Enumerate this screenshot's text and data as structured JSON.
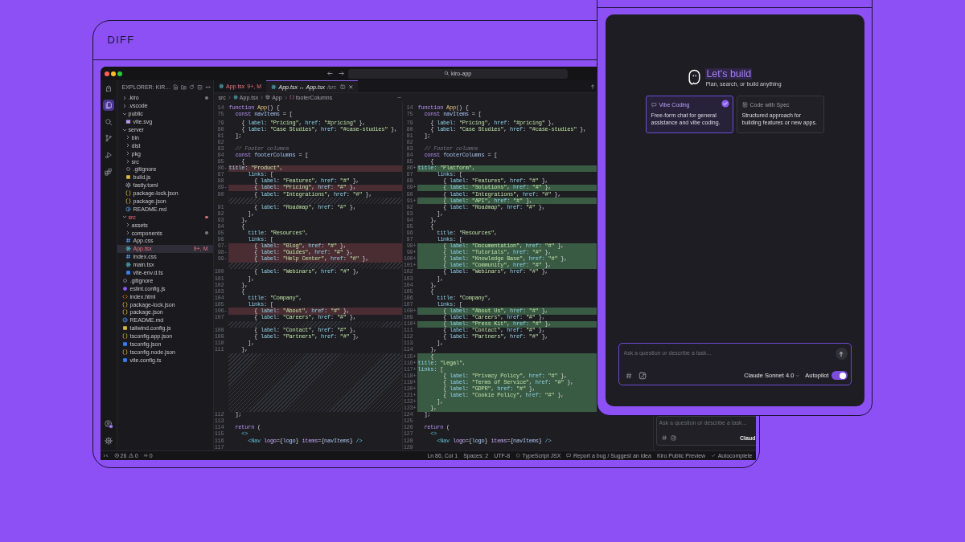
{
  "frame": {
    "label": "DIFF"
  },
  "title_bar": {
    "search": "kiro-app"
  },
  "activity_bar": {
    "top": [
      {
        "kind": "logo",
        "selected": false
      },
      {
        "kind": "explorer",
        "selected": true
      },
      {
        "kind": "search",
        "selected": false
      },
      {
        "kind": "source_control",
        "selected": false
      },
      {
        "kind": "run",
        "selected": false
      },
      {
        "kind": "extensions",
        "selected": false
      }
    ],
    "bottom": [
      {
        "kind": "account"
      },
      {
        "kind": "settings"
      }
    ]
  },
  "explorer": {
    "title": "EXPLORER: KIR…",
    "tree": [
      {
        "name": ".kiro",
        "kind": "folder",
        "expanded": false,
        "selected": false,
        "modified": false,
        "dot": true
      },
      {
        "name": ".vscode",
        "kind": "folder",
        "expanded": false,
        "selected": false,
        "modified": false,
        "dot": false
      },
      {
        "name": "public",
        "kind": "folder",
        "expanded": true,
        "selected": false,
        "modified": false,
        "dot": false,
        "children": [
          {
            "name": "vite.svg",
            "kind": "image",
            "selected": false,
            "modified": false,
            "dot": false
          }
        ]
      },
      {
        "name": "server",
        "kind": "folder",
        "expanded": true,
        "selected": false,
        "modified": false,
        "dot": false,
        "children": [
          {
            "name": "bin",
            "kind": "folder",
            "expanded": false,
            "selected": false,
            "modified": false,
            "dot": false
          },
          {
            "name": "dist",
            "kind": "folder",
            "expanded": false,
            "selected": false,
            "modified": false,
            "dot": false
          },
          {
            "name": "pkg",
            "kind": "folder",
            "expanded": false,
            "selected": false,
            "modified": false,
            "dot": false
          },
          {
            "name": "src",
            "kind": "folder",
            "expanded": false,
            "selected": false,
            "modified": false,
            "dot": false
          },
          {
            "name": ".gitignore",
            "kind": "git",
            "selected": false,
            "modified": false,
            "dot": false
          },
          {
            "name": "build.js",
            "kind": "js",
            "selected": false,
            "modified": false,
            "dot": false
          },
          {
            "name": "fastly.toml",
            "kind": "config",
            "selected": false,
            "modified": false,
            "dot": false
          },
          {
            "name": "package-lock.json",
            "kind": "json",
            "selected": false,
            "modified": false,
            "dot": false
          },
          {
            "name": "package.json",
            "kind": "json",
            "selected": false,
            "modified": false,
            "dot": false
          },
          {
            "name": "README.md",
            "kind": "info",
            "selected": false,
            "modified": false,
            "dot": false
          }
        ]
      },
      {
        "name": "src",
        "kind": "folder",
        "expanded": true,
        "selected": false,
        "modified": true,
        "dot": true,
        "children": [
          {
            "name": "assets",
            "kind": "folder",
            "expanded": false,
            "selected": false,
            "modified": false,
            "dot": false
          },
          {
            "name": "components",
            "kind": "folder",
            "expanded": false,
            "selected": false,
            "modified": false,
            "dot": true
          },
          {
            "name": "App.css",
            "kind": "css",
            "selected": false,
            "modified": false,
            "dot": false
          },
          {
            "name": "App.tsx",
            "kind": "react",
            "selected": true,
            "modified": true,
            "dot": false,
            "badge": "9+, M"
          },
          {
            "name": "index.css",
            "kind": "css",
            "selected": false,
            "modified": false,
            "dot": false
          },
          {
            "name": "main.tsx",
            "kind": "react",
            "selected": false,
            "modified": false,
            "dot": false
          },
          {
            "name": "vite-env.d.ts",
            "kind": "ts",
            "selected": false,
            "modified": false,
            "dot": false
          }
        ]
      },
      {
        "name": ".gitignore",
        "kind": "git",
        "selected": false,
        "modified": false,
        "dot": false
      },
      {
        "name": "eslint.config.js",
        "kind": "eslint",
        "selected": false,
        "modified": false,
        "dot": false
      },
      {
        "name": "index.html",
        "kind": "html",
        "selected": false,
        "modified": false,
        "dot": false
      },
      {
        "name": "package-lock.json",
        "kind": "json",
        "selected": false,
        "modified": false,
        "dot": false
      },
      {
        "name": "package.json",
        "kind": "json",
        "selected": false,
        "modified": false,
        "dot": false
      },
      {
        "name": "README.md",
        "kind": "info",
        "selected": false,
        "modified": false,
        "dot": false
      },
      {
        "name": "tailwind.config.js",
        "kind": "js",
        "selected": false,
        "modified": false,
        "dot": false
      },
      {
        "name": "tsconfig.app.json",
        "kind": "json",
        "selected": false,
        "modified": false,
        "dot": false
      },
      {
        "name": "tsconfig.json",
        "kind": "ts",
        "selected": false,
        "modified": false,
        "dot": false
      },
      {
        "name": "tsconfig.node.json",
        "kind": "json",
        "selected": false,
        "modified": false,
        "dot": false
      },
      {
        "name": "vite.config.ts",
        "kind": "ts",
        "selected": false,
        "modified": false,
        "dot": false
      }
    ]
  },
  "tabs": [
    {
      "label": "App.tsx",
      "badge": "9+, M",
      "selected": false,
      "modified": true,
      "preview": false
    },
    {
      "label": "App.tsx ↔ App.tsx",
      "detail": "/src",
      "selected": true,
      "modified": false,
      "preview": true
    }
  ],
  "breadcrumb": [
    {
      "label": "src",
      "kind": "folder"
    },
    {
      "label": "App.tsx",
      "kind": "react"
    },
    {
      "label": "App",
      "kind": "function"
    },
    {
      "label": "footerColumns",
      "kind": "variable"
    }
  ],
  "diff": {
    "left": [
      {
        "line": "14",
        "code": "function App() {",
        "kind": "sticky"
      },
      {
        "line": "75",
        "code": "  const navItems = [",
        "kind": "sticky"
      },
      {
        "line": "79",
        "code": "    { label: \"Pricing\", href: \"#pricing\" },",
        "kind": "context"
      },
      {
        "line": "80",
        "code": "    { label: \"Case Studies\", href: \"#case-studies\" },",
        "kind": "context"
      },
      {
        "line": "81",
        "code": "  ];",
        "kind": "context"
      },
      {
        "line": "82",
        "kind": "context"
      },
      {
        "line": "83",
        "code": "  // Footer columns",
        "kind": "context"
      },
      {
        "line": "84",
        "code": "  const footerColumns = [",
        "kind": "context"
      },
      {
        "line": "85",
        "code": "    {",
        "kind": "context"
      },
      {
        "line": "86",
        "marker": "-",
        "code": "      title: \"Product\",",
        "kind": "removed"
      },
      {
        "line": "87",
        "code": "      links: [",
        "kind": "context"
      },
      {
        "line": "88",
        "code": "        { label: \"Features\", href: \"#\" },",
        "kind": "context"
      },
      {
        "line": "89",
        "marker": "-",
        "code": "        { label: \"Pricing\", href: \"#\" },",
        "kind": "removed"
      },
      {
        "line": "90",
        "code": "        { label: \"Integrations\", href: \"#\" },",
        "kind": "context"
      },
      {
        "kind": "filler"
      },
      {
        "line": "91",
        "code": "        { label: \"Roadmap\", href: \"#\" },",
        "kind": "context"
      },
      {
        "line": "92",
        "code": "      ],",
        "kind": "context"
      },
      {
        "line": "93",
        "code": "    },",
        "kind": "context"
      },
      {
        "line": "94",
        "code": "    {",
        "kind": "context"
      },
      {
        "line": "95",
        "code": "      title: \"Resources\",",
        "kind": "context"
      },
      {
        "line": "96",
        "code": "      links: [",
        "kind": "context"
      },
      {
        "line": "97",
        "marker": "-",
        "code": "        { label: \"Blog\", href: \"#\" },",
        "kind": "removed"
      },
      {
        "line": "98",
        "marker": "-",
        "code": "        { label: \"Guides\", href: \"#\" },",
        "kind": "removed"
      },
      {
        "line": "99",
        "marker": "-",
        "code": "        { label: \"Help Center\", href: \"#\" },",
        "kind": "removed"
      },
      {
        "kind": "filler"
      },
      {
        "line": "100",
        "code": "        { label: \"Webinars\", href: \"#\" },",
        "kind": "context"
      },
      {
        "line": "101",
        "code": "      ],",
        "kind": "context"
      },
      {
        "line": "102",
        "code": "    },",
        "kind": "context"
      },
      {
        "line": "103",
        "code": "    {",
        "kind": "context"
      },
      {
        "line": "104",
        "code": "      title: \"Company\",",
        "kind": "context"
      },
      {
        "line": "105",
        "code": "      links: [",
        "kind": "context"
      },
      {
        "line": "106",
        "marker": "-",
        "code": "        { label: \"About\", href: \"#\" },",
        "kind": "removed"
      },
      {
        "line": "107",
        "code": "        { label: \"Careers\", href: \"#\" },",
        "kind": "context"
      },
      {
        "kind": "filler"
      },
      {
        "line": "108",
        "code": "        { label: \"Contact\", href: \"#\" },",
        "kind": "context"
      },
      {
        "line": "109",
        "code": "        { label: \"Partners\", href: \"#\" },",
        "kind": "context"
      },
      {
        "line": "110",
        "code": "      ],",
        "kind": "context"
      },
      {
        "line": "111",
        "code": "    },",
        "kind": "context"
      },
      {
        "kind": "filler"
      },
      {
        "kind": "filler"
      },
      {
        "kind": "filler"
      },
      {
        "kind": "filler"
      },
      {
        "kind": "filler"
      },
      {
        "kind": "filler"
      },
      {
        "kind": "filler"
      },
      {
        "kind": "filler"
      },
      {
        "kind": "filler"
      },
      {
        "line": "112",
        "code": "  ];",
        "kind": "context"
      },
      {
        "line": "113",
        "kind": "context"
      },
      {
        "line": "114",
        "code": "  return (",
        "kind": "context"
      },
      {
        "line": "115",
        "code": "    <>",
        "kind": "context"
      },
      {
        "line": "116",
        "code": "      <Nav logo={logo} items={navItems} />",
        "kind": "context"
      },
      {
        "line": "117",
        "kind": "context"
      }
    ],
    "right": [
      {
        "line": "14",
        "code": "function App() {",
        "kind": "sticky"
      },
      {
        "line": "75",
        "code": "  const navItems = [",
        "kind": "sticky"
      },
      {
        "line": "79",
        "code": "    { label: \"Pricing\", href: \"#pricing\" },",
        "kind": "context"
      },
      {
        "line": "80",
        "code": "    { label: \"Case Studies\", href: \"#case-studies\" },",
        "kind": "context"
      },
      {
        "line": "81",
        "code": "  ];",
        "kind": "context"
      },
      {
        "line": "82",
        "kind": "context"
      },
      {
        "line": "83",
        "code": "  // Footer columns",
        "kind": "context"
      },
      {
        "line": "84",
        "code": "  const footerColumns = [",
        "kind": "context"
      },
      {
        "line": "85",
        "code": "    {",
        "kind": "context"
      },
      {
        "line": "86",
        "marker": "+",
        "code": "      title: \"Platform\",",
        "kind": "added"
      },
      {
        "line": "87",
        "code": "      links: [",
        "kind": "context"
      },
      {
        "line": "88",
        "code": "        { label: \"Features\", href: \"#\" },",
        "kind": "context"
      },
      {
        "line": "89",
        "marker": "+",
        "code": "        { label: \"Solutions\", href: \"#\" },",
        "kind": "added"
      },
      {
        "line": "90",
        "code": "        { label: \"Integrations\", href: \"#\" },",
        "kind": "context"
      },
      {
        "line": "91",
        "marker": "+",
        "code": "        { label: \"API\", href: \"#\" },",
        "kind": "added"
      },
      {
        "line": "92",
        "code": "        { label: \"Roadmap\", href: \"#\" },",
        "kind": "context"
      },
      {
        "line": "93",
        "code": "      ],",
        "kind": "context"
      },
      {
        "line": "94",
        "code": "    },",
        "kind": "context"
      },
      {
        "line": "95",
        "code": "    {",
        "kind": "context"
      },
      {
        "line": "96",
        "code": "      title: \"Resources\",",
        "kind": "context"
      },
      {
        "line": "97",
        "code": "      links: [",
        "kind": "context"
      },
      {
        "line": "98",
        "marker": "+",
        "code": "        { label: \"Documentation\", href: \"#\" },",
        "kind": "added"
      },
      {
        "line": "99",
        "marker": "+",
        "code": "        { label: \"Tutorials\", href: \"#\" },",
        "kind": "added"
      },
      {
        "line": "100",
        "marker": "+",
        "code": "        { label: \"Knowledge Base\", href: \"#\" },",
        "kind": "added"
      },
      {
        "line": "101",
        "marker": "+",
        "code": "        { label: \"Community\", href: \"#\" },",
        "kind": "added"
      },
      {
        "line": "102",
        "code": "        { label: \"Webinars\", href: \"#\" },",
        "kind": "context"
      },
      {
        "line": "103",
        "code": "      ],",
        "kind": "context"
      },
      {
        "line": "104",
        "code": "    },",
        "kind": "context"
      },
      {
        "line": "105",
        "code": "    {",
        "kind": "context"
      },
      {
        "line": "106",
        "code": "      title: \"Company\",",
        "kind": "context"
      },
      {
        "line": "107",
        "code": "      links: [",
        "kind": "context"
      },
      {
        "line": "108",
        "marker": "+",
        "code": "        { label: \"About Us\", href: \"#\" },",
        "kind": "added"
      },
      {
        "line": "109",
        "code": "        { label: \"Careers\", href: \"#\" },",
        "kind": "context"
      },
      {
        "line": "110",
        "marker": "+",
        "code": "        { label: \"Press Kit\", href: \"#\" },",
        "kind": "added"
      },
      {
        "line": "111",
        "code": "        { label: \"Contact\", href: \"#\" },",
        "kind": "context"
      },
      {
        "line": "112",
        "code": "        { label: \"Partners\", href: \"#\" },",
        "kind": "context"
      },
      {
        "line": "113",
        "code": "      ],",
        "kind": "context"
      },
      {
        "line": "114",
        "code": "    },",
        "kind": "context"
      },
      {
        "line": "115",
        "marker": "+",
        "code": "    {",
        "kind": "added"
      },
      {
        "line": "116",
        "marker": "+",
        "code": "      title: \"Legal\",",
        "kind": "added"
      },
      {
        "line": "117",
        "marker": "+",
        "code": "      links: [",
        "kind": "added"
      },
      {
        "line": "118",
        "marker": "+",
        "code": "        { label: \"Privacy Policy\", href: \"#\" },",
        "kind": "added"
      },
      {
        "line": "119",
        "marker": "+",
        "code": "        { label: \"Terms of Service\", href: \"#\" },",
        "kind": "added"
      },
      {
        "line": "120",
        "marker": "+",
        "code": "        { label: \"GDPR\", href: \"#\" },",
        "kind": "added"
      },
      {
        "line": "121",
        "marker": "+",
        "code": "        { label: \"Cookie Policy\", href: \"#\" },",
        "kind": "added"
      },
      {
        "line": "122",
        "marker": "+",
        "code": "      ],",
        "kind": "added"
      },
      {
        "line": "123",
        "marker": "+",
        "code": "    },",
        "kind": "added"
      },
      {
        "line": "124",
        "code": "  ];",
        "kind": "context"
      },
      {
        "line": "125",
        "kind": "context"
      },
      {
        "line": "126",
        "code": "  return (",
        "kind": "context"
      },
      {
        "line": "127",
        "code": "    <>",
        "kind": "context"
      },
      {
        "line": "128",
        "code": "      <Nav logo={logo} items={navItems} />",
        "kind": "context"
      },
      {
        "line": "129",
        "kind": "context"
      }
    ]
  },
  "chat_peek": {
    "placeholder": "Ask a question or describe a task...",
    "model": "Claud"
  },
  "status_bar": {
    "left": [
      {
        "kind": "remote"
      },
      {
        "kind": "problems",
        "errors": "26",
        "warnings": "0"
      },
      {
        "kind": "ports",
        "text": "0"
      }
    ],
    "right": [
      {
        "kind": "plain",
        "text": "Ln 86, Col 1"
      },
      {
        "kind": "plain",
        "text": "Spaces: 2"
      },
      {
        "kind": "plain",
        "text": "UTF-8"
      },
      {
        "kind": "language",
        "text": "TypeScript JSX"
      },
      {
        "kind": "feedback",
        "text": "Report a bug / Suggest an idea"
      },
      {
        "kind": "plain",
        "text": "Kiro Public Preview"
      },
      {
        "kind": "check",
        "text": "Autocomplete"
      }
    ]
  },
  "chat_overlay": {
    "heading": "Let's build",
    "subheading": "Plan, search, or build anything",
    "modes": [
      {
        "kind": "chat",
        "title": "Vibe Coding",
        "description": "Free-form chat for general assistance and vibe coding.",
        "selected": true
      },
      {
        "kind": "spec",
        "title": "Code with Spec",
        "description": "Structured approach for building features or new apps.",
        "selected": false
      }
    ],
    "input": {
      "placeholder": "Ask a question or describe a task..."
    },
    "model": "Claude Sonnet 4.0",
    "autopilot": {
      "label": "Autopilot",
      "on": true
    }
  }
}
